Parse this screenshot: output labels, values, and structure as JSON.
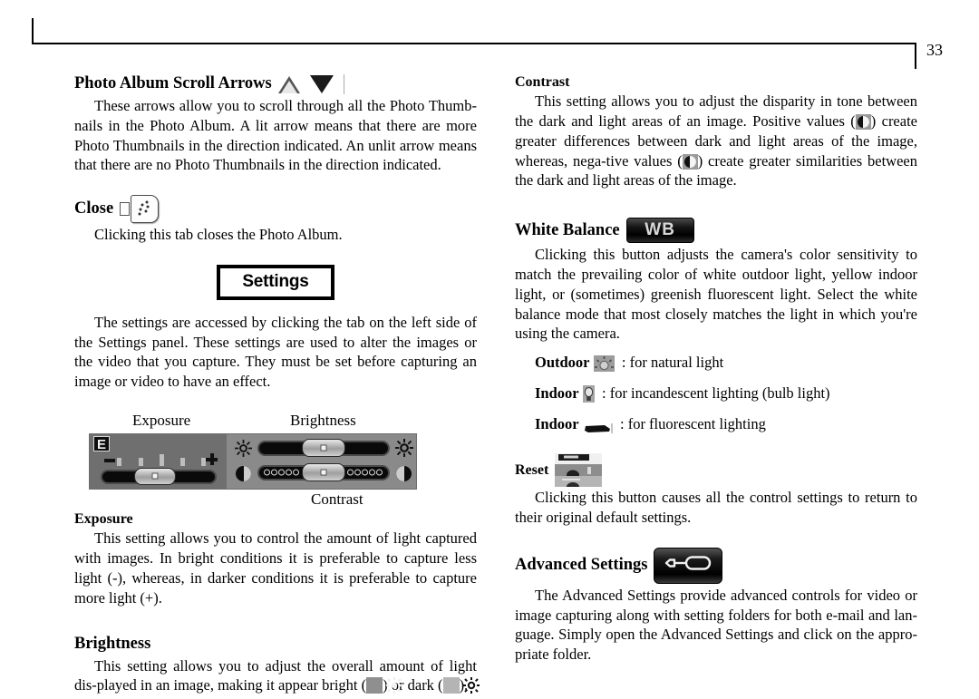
{
  "page": {
    "number": "33"
  },
  "left_column": {
    "scroll_arrows": {
      "heading": "Photo Album Scroll Arrows",
      "icon_up": "scroll-up-arrow-icon",
      "icon_down": "scroll-down-arrow-icon",
      "body": "These arrows allow you to scroll through all the Photo Thumb-nails in the Photo Album.  A lit arrow means that there are more Photo Thumbnails in the direction indicated.  An unlit arrow means that there are no Photo Thumbnails in the direction indicated."
    },
    "close": {
      "heading": "Close",
      "icon": "close-tab-icon",
      "body": "Clicking this tab closes the Photo Album."
    },
    "settings_banner": "Settings",
    "settings_intro": "The settings are accessed by clicking the tab on the left side of the Settings panel. These settings are used to alter the images or the video that you capture. They must be set before capturing an image or video to have an effect.",
    "control_panel": {
      "label_exposure": "Exposure",
      "label_brightness": "Brightness",
      "label_contrast": "Contrast",
      "exposure_badge": "E",
      "exposure_minus": "-",
      "exposure_plus": "+"
    },
    "exposure": {
      "heading": "Exposure",
      "body": "This setting allows you to control the amount of light captured with images.  In bright conditions it is preferable to capture less light (-), whereas, in darker conditions it is preferable to capture more light (+)."
    },
    "brightness": {
      "heading": "Brightness",
      "body_part1": "This setting allows you to adjust the overall amount of light dis-played in an image, making it appear bright (",
      "body_part2": ") or dark (",
      "body_part3": ").",
      "icon_bright": "bright-sun-icon",
      "icon_dark": "dark-sun-icon"
    }
  },
  "right_column": {
    "contrast": {
      "heading": "Contrast",
      "body_part1": "This setting allows you to adjust the disparity in tone between the dark and light areas of an image. Positive values (",
      "body_part2": ") create greater differences between dark and light areas of the image, whereas, nega-tive values (",
      "body_part3": ") create greater similarities between the dark and light areas of the image.",
      "icon_positive": "contrast-positive-icon",
      "icon_negative": "contrast-negative-icon"
    },
    "white_balance": {
      "heading": "White Balance",
      "button_label": "WB",
      "body": "Clicking this button adjusts the camera's color sensitivity to match the prevailing color of white outdoor light, yellow indoor light, or (sometimes) greenish fluorescent light. Select the white balance mode that most closely matches the light in which you're using the camera.",
      "modes": [
        {
          "name": "Outdoor",
          "icon": "outdoor-sun-icon",
          "description": ": for natural light"
        },
        {
          "name": "Indoor",
          "icon": "incandescent-bulb-icon",
          "description": ": for incandescent lighting (bulb light)"
        },
        {
          "name": "Indoor",
          "icon": "fluorescent-tube-icon",
          "description": ": for fluorescent lighting"
        }
      ]
    },
    "reset": {
      "heading": "Reset",
      "icon": "reset-button-icon",
      "body": "Clicking this button causes all the control settings to return to their original default settings."
    },
    "advanced_settings": {
      "heading": "Advanced Settings",
      "icon": "screwdriver-icon",
      "body": "The Advanced Settings provide advanced controls for video or image capturing along with setting folders for both e-mail and lan-guage.  Simply open the Advanced Settings and click on the appro-priate folder."
    }
  }
}
